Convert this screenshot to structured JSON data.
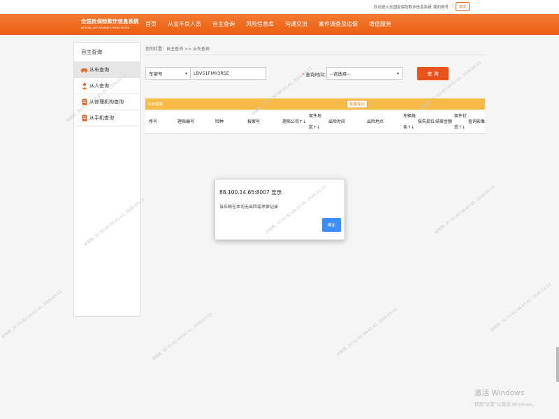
{
  "topbar": {
    "welcome": "欢迎进入全国反保险欺诈信息系统",
    "separator": "|",
    "account": "我的账号",
    "logout": "退出"
  },
  "logo": {
    "title_cn": "全国反保险欺诈信息系统",
    "title_en": "NATIONAL ANTI INSURANCE FRAUD SYSTEM"
  },
  "nav": {
    "items": [
      "首页",
      "从业不良人员",
      "自主查询",
      "风险信息库",
      "沟通交流",
      "案件调查及追偿",
      "增值服务"
    ]
  },
  "sidebar": {
    "title": "自主查询",
    "items": [
      {
        "label": "从车查询",
        "icon": "car-icon"
      },
      {
        "label": "从人查询",
        "icon": "person-icon"
      },
      {
        "label": "从修理机构查询",
        "icon": "document-icon"
      },
      {
        "label": "从手机查询",
        "icon": "document-icon"
      }
    ]
  },
  "breadcrumb": "您的位置：自主查询 >> 从车查询",
  "search": {
    "type_selected": "车架号",
    "plate_value": "LBV51FM03RSE",
    "time_label": "查询时间：",
    "time_required_mark": "*",
    "time_selected": "--请选择--",
    "query_button": "查 询"
  },
  "table": {
    "tab_label": "历史赔案",
    "export_button": "批量导出",
    "columns": [
      {
        "line1": "序号",
        "line2": ""
      },
      {
        "line1": "理赔编号",
        "line2": ""
      },
      {
        "line1": "险种",
        "line2": ""
      },
      {
        "line1": "报案号",
        "line2": ""
      },
      {
        "line1": "理赔公司↑↓",
        "line2": ""
      },
      {
        "line1": "案件地",
        "line2": "区↑↓"
      },
      {
        "line1": "出险时间",
        "line2": ""
      },
      {
        "line1": "出险地点",
        "line2": ""
      },
      {
        "line1": "车辆角",
        "line2": "色↑↓"
      },
      {
        "line1": "损失部位",
        "line2": ""
      },
      {
        "line1": "结案金额",
        "line2": ""
      },
      {
        "line1": "案件状",
        "line2": "态↑↓"
      },
      {
        "line1": "查询影像",
        "line2": ""
      }
    ]
  },
  "dialog": {
    "title": "88.100.14.65:8007 显示",
    "message": "该车辆在本司无出险或承保记录",
    "ok": "确定"
  },
  "watermark": "谷铭燕, 3C-52-82-0A-82-41, 2026-03-13",
  "windows_activation": {
    "line1": "激活 Windows",
    "line2": "转到\"设置\"以激活 Windows。"
  }
}
